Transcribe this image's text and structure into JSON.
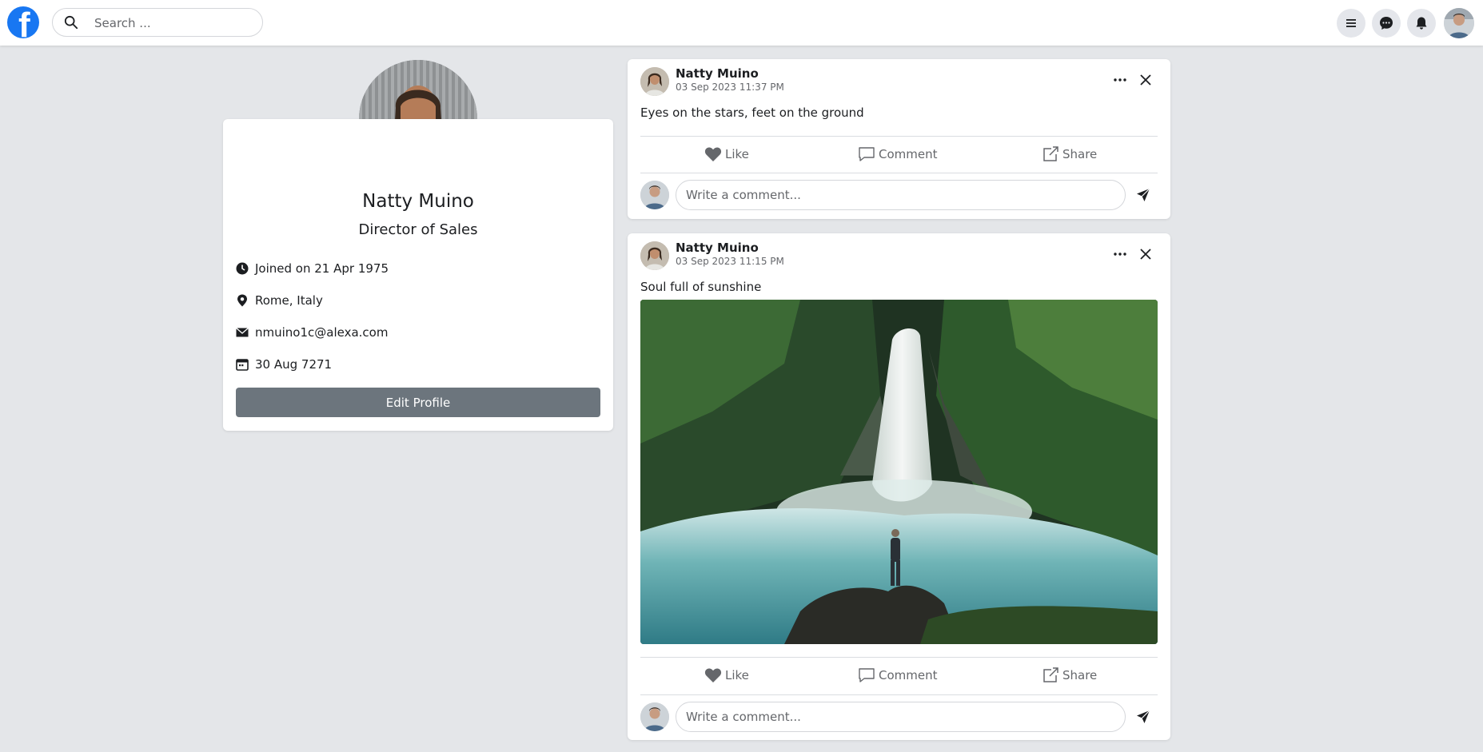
{
  "topbar": {
    "logo_letter": "f",
    "search_placeholder": "Search ...",
    "icons": [
      "menu-icon",
      "messenger-icon",
      "bell-icon"
    ]
  },
  "profile": {
    "name": "Natty Muino",
    "title": "Director of Sales",
    "joined": "Joined on 21 Apr 1975",
    "location": "Rome, Italy",
    "email": "nmuino1c@alexa.com",
    "date": "30 Aug 7271",
    "edit_label": "Edit Profile"
  },
  "posts": [
    {
      "author": "Natty Muino",
      "time": "03 Sep 2023 11:37 PM",
      "text": "Eyes on the stars, feet on the ground",
      "like_label": "Like",
      "comment_label": "Comment",
      "share_label": "Share",
      "comment_placeholder": "Write a comment..."
    },
    {
      "author": "Natty Muino",
      "time": "03 Sep 2023 11:15 PM",
      "text": "Soul full of sunshine",
      "image_icon": "waterfall-photo",
      "like_label": "Like",
      "comment_label": "Comment",
      "share_label": "Share",
      "comment_placeholder": "Write a comment..."
    }
  ],
  "colors": {
    "brand": "#1877f2",
    "background": "#e4e6e9",
    "edit_button": "#6c757d"
  }
}
